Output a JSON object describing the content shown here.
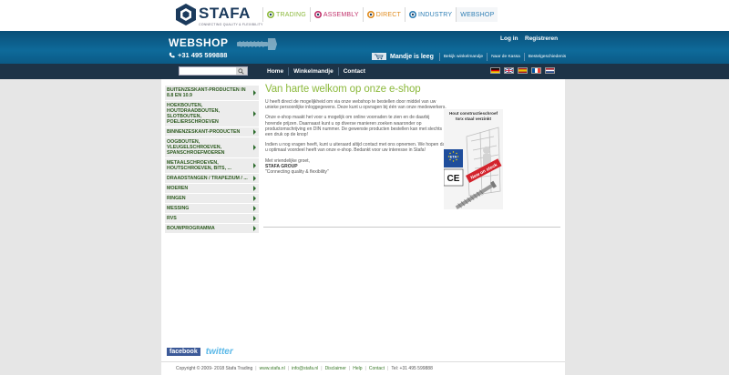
{
  "brand": {
    "name": "STAFA",
    "tagline": "CONNECTING QUALITY & FLEXIBILITY"
  },
  "topnav": [
    {
      "label": "TRADING",
      "color": "#8cb93c"
    },
    {
      "label": "ASSEMBLY",
      "color": "#c0306a"
    },
    {
      "label": "DIRECT",
      "color": "#e08b1e"
    },
    {
      "label": "INDUSTRY",
      "color": "#2f7fb5"
    },
    {
      "label": "WEBSHOP",
      "color": "#2f7fb5"
    }
  ],
  "header": {
    "title": "WEBSHOP",
    "phone": "+31 495 599888",
    "login": "Log in",
    "register": "Registreren",
    "cart_status": "Mandje is leeg",
    "cart_buttons": [
      "Bekijk winkelmandje",
      "Naar de Kassa",
      "Bestelgeschiedenis"
    ]
  },
  "menu": {
    "search_placeholder": "",
    "items": [
      "Home",
      "Winkelmandje",
      "Contact"
    ],
    "flags": [
      "de",
      "en",
      "es",
      "fr",
      "nl"
    ]
  },
  "sidebar": {
    "categories": [
      "BUITENZESKANT-PRODUCTEN IN 8.8 EN 10.9",
      "HOEKBOUTEN, HOUTDRAADBOUTEN, SLOTBOUTEN, POELIERSCHROEVEN",
      "BINNENZESKANT-PRODUCTEN",
      "OOGBOUTEN, VLEUGELSCHROEVEN, SPANSCHROEFMOEREN",
      "METAALSCHROEVEN, HOUTSCHROEVEN, BITS, ...",
      "DRAADSTANGEN / TRAPEZIUM / ...",
      "MOEREN",
      "RINGEN",
      "MESSING",
      "RVS",
      "BOUWPROGRAMMA"
    ]
  },
  "content": {
    "heading": "Van harte welkom op onze e-shop",
    "paragraphs": [
      "U heeft direct de mogelijkheid om via onze webshop te bestellen door middel van uw unieke persoonlijke inloggegevens. Deze kunt u opvragen bij één van onze medewerkers.",
      "Onze e-shop maakt het voor u mogelijk om online voorraden te zien en de daarbij horende prijzen. Daarnaast kunt u op diverse manieren zoeken waaronder op productomschrijving en DIN nummer. De gewenste producten bestellen kan met slechts een druk op de knop!",
      "Indien u nog vragen heeft, kunt u uiteraard altijd contact met ons opnemen. We hopen dat u optimaal voordeel heeft van onze e-shop. Bedankt voor uw interesse in Stafa!"
    ],
    "greeting": "Met vriendelijke groet,",
    "company": "STAFA GROUP",
    "motto": "\"Connecting quality & flexibility\""
  },
  "promo": {
    "title_line1": "Hout constructieschroef",
    "title_line2": "torx staal verzinkt",
    "badge": "New on stock",
    "eta_label": "ETA",
    "ce_label": "CE"
  },
  "social": {
    "facebook": "facebook",
    "twitter": "twitter"
  },
  "footer": {
    "copyright": "Copyright © 2009- 2018 Stafa Trading",
    "links": [
      "www.stafa.nl",
      "info@stafa.nl",
      "Disclaimer",
      "Help",
      "Contact"
    ],
    "phone": "Tel: +31 495 599888"
  }
}
